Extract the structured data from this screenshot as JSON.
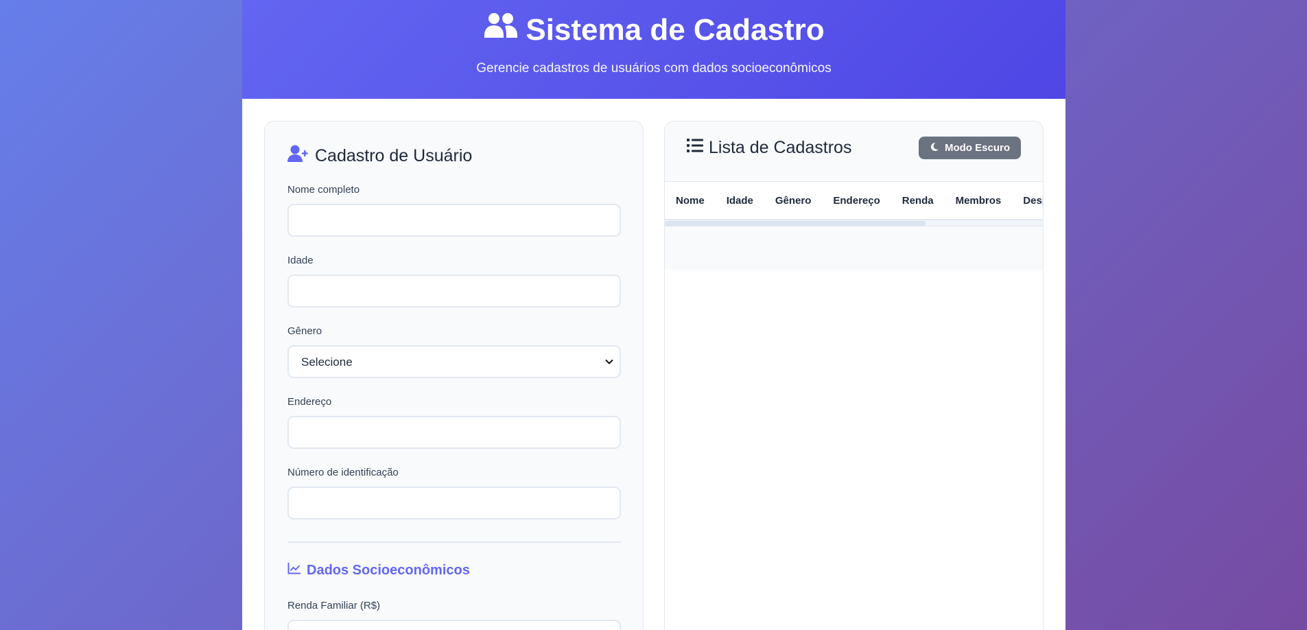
{
  "header": {
    "title": "Sistema de Cadastro",
    "subtitle": "Gerencie cadastros de usuários com dados socioeconômicos",
    "icon": "users-icon"
  },
  "form": {
    "title": "Cadastro de Usuário",
    "icon": "user-plus-icon",
    "fields": {
      "nome": {
        "label": "Nome completo",
        "value": ""
      },
      "idade": {
        "label": "Idade",
        "value": ""
      },
      "genero": {
        "label": "Gênero",
        "selected": "Selecione"
      },
      "endereco": {
        "label": "Endereço",
        "value": ""
      },
      "identificacao": {
        "label": "Número de identificação",
        "value": ""
      }
    },
    "socio": {
      "title": "Dados Socioeconômicos",
      "icon": "chart-line-icon",
      "renda_label": "Renda Familiar (R$)"
    }
  },
  "list": {
    "title": "Lista de Cadastros",
    "icon": "list-icon",
    "dark_mode_button": "Modo Escuro",
    "dark_mode_icon": "moon-icon",
    "columns": [
      "Nome",
      "Idade",
      "Gênero",
      "Endereço",
      "Renda",
      "Membros",
      "Desp"
    ]
  },
  "colors": {
    "accent": "#6366f1",
    "header_start": "#6366f1",
    "header_end": "#4f46e5",
    "button_gray": "#6b7280"
  }
}
